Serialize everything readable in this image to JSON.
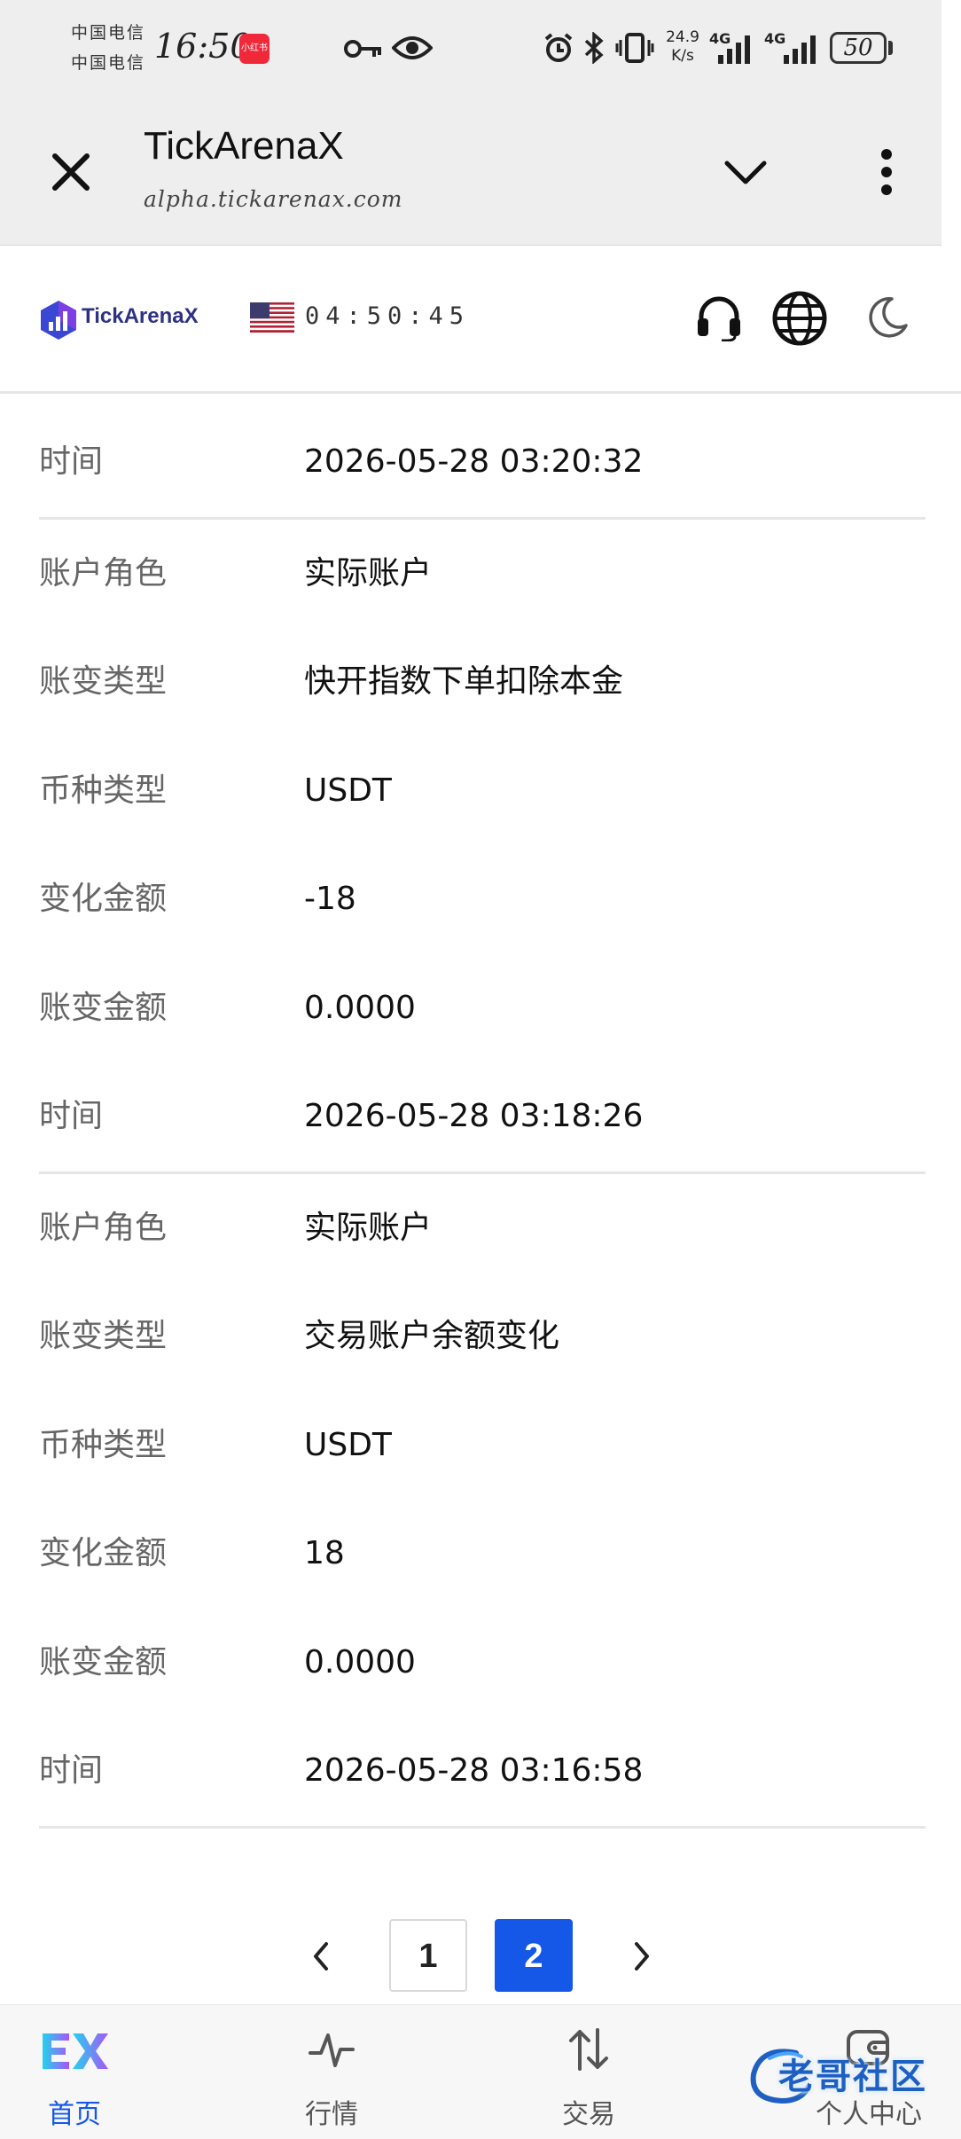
{
  "status_bar": {
    "carrier_1": "中国电信",
    "carrier_2": "中国电信",
    "time": "16:50",
    "app_badge": "小红书",
    "net_speed_value": "24.9",
    "net_speed_unit": "K/s",
    "signal_1": "4G",
    "signal_2": "4G",
    "battery": "50"
  },
  "browser": {
    "title": "TickArenaX",
    "url": "alpha.tickarenax.com"
  },
  "header": {
    "brand": "TickArenaX",
    "clock": "04:50:45"
  },
  "records": [
    {
      "rows": [
        {
          "label": "时间",
          "value": "2026-05-28 03:20:32"
        }
      ]
    },
    {
      "rows": [
        {
          "label": "账户角色",
          "value": "实际账户"
        },
        {
          "label": "账变类型",
          "value": "快开指数下单扣除本金"
        },
        {
          "label": "币种类型",
          "value": "USDT"
        },
        {
          "label": "变化金额",
          "value": "-18"
        },
        {
          "label": "账变金额",
          "value": "0.0000"
        },
        {
          "label": "时间",
          "value": "2026-05-28 03:18:26"
        }
      ]
    },
    {
      "rows": [
        {
          "label": "账户角色",
          "value": "实际账户"
        },
        {
          "label": "账变类型",
          "value": "交易账户余额变化"
        },
        {
          "label": "币种类型",
          "value": "USDT"
        },
        {
          "label": "变化金额",
          "value": "18"
        },
        {
          "label": "账变金额",
          "value": "0.0000"
        },
        {
          "label": "时间",
          "value": "2026-05-28 03:16:58"
        }
      ]
    }
  ],
  "pagination": {
    "pages": [
      "1",
      "2"
    ],
    "current": "2",
    "prev_icon": "chevron-left-icon",
    "next_icon": "chevron-right-icon"
  },
  "bottom_nav": [
    {
      "label": "首页",
      "icon": "ex-logo-icon",
      "active": true
    },
    {
      "label": "行情",
      "icon": "pulse-icon",
      "active": false
    },
    {
      "label": "交易",
      "icon": "swap-arrows-icon",
      "active": false
    },
    {
      "label": "个人中心",
      "icon": "wallet-icon",
      "active": false
    }
  ],
  "watermark": "老哥社区",
  "colors": {
    "accent": "#1558e8",
    "label": "#666666",
    "value": "#111111",
    "divider": "#e6e6e6",
    "brand": "#2d3282"
  }
}
